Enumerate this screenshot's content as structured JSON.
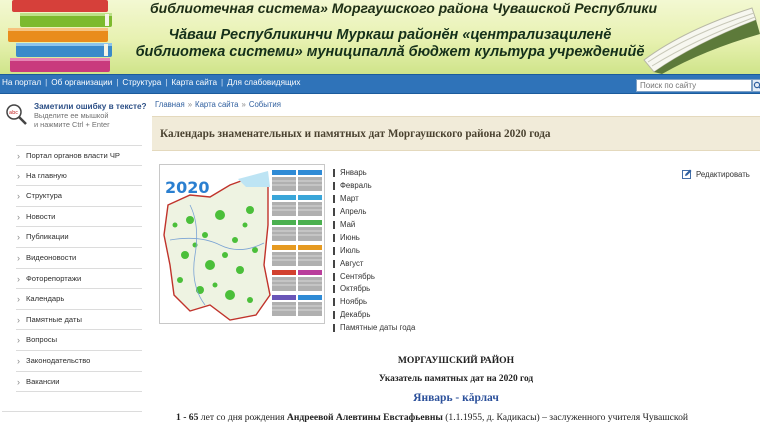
{
  "header": {
    "line1": "библиотечная система» Моргаушского района Чувашской Республики",
    "line2": "Чăваш Республикинчи Муркаш районĕн «централизациленĕ библиотека системи» муниципаллă бюджет культура учрежденийĕ"
  },
  "topnav": {
    "items": [
      "На портал",
      "Об организации",
      "Структура",
      "Карта сайта",
      "Для слабовидящих"
    ],
    "search_placeholder": "Поиск по сайту"
  },
  "typo_widget": {
    "title": "Заметили ошибку в тексте?",
    "hint_line1": "Выделите ее мышкой",
    "hint_line2": "и нажмите Ctrl + Enter"
  },
  "sidebar": {
    "items": [
      "Портал органов власти ЧР",
      "На главную",
      "Структура",
      "Новости",
      "Публикации",
      "Видеоновости",
      "Фоторепортажи",
      "Календарь",
      "Памятные даты",
      "Вопросы",
      "Законодательство",
      "Вакансии"
    ]
  },
  "breadcrumbs": [
    "Главная",
    "Карта сайта",
    "События"
  ],
  "page_title": "Календарь знаменательных и памятных дат Моргаушского района 2020 года",
  "illustration": {
    "year": "2020",
    "icon": "calendar-map-image"
  },
  "months": [
    "Январь",
    "Февраль",
    "Март",
    "Апрель",
    "Май",
    "Июнь",
    "Июль",
    "Август",
    "Сентябрь",
    "Октябрь",
    "Ноябрь",
    "Декабрь",
    "Памятные даты года"
  ],
  "edit_label": "Редактировать",
  "article": {
    "heading1": "МОРГАУШСКИЙ РАЙОН",
    "heading2": "Указатель памятных дат на 2020 год",
    "heading3": "Январь - кăрлач",
    "para_prefix": "1 - 65",
    "para_text1": " лет со дня рождения ",
    "para_name": "Андреевой Алевтины Евстафьевны",
    "para_text2": " (1.1.1955, д. Кадикасы) – заслуженного учителя Чувашской"
  },
  "colors": {
    "nav_bg": "#2f73b9",
    "title_bg": "#f1ebd9",
    "link": "#2f5f9f",
    "month_heading": "#2a4f9a"
  }
}
